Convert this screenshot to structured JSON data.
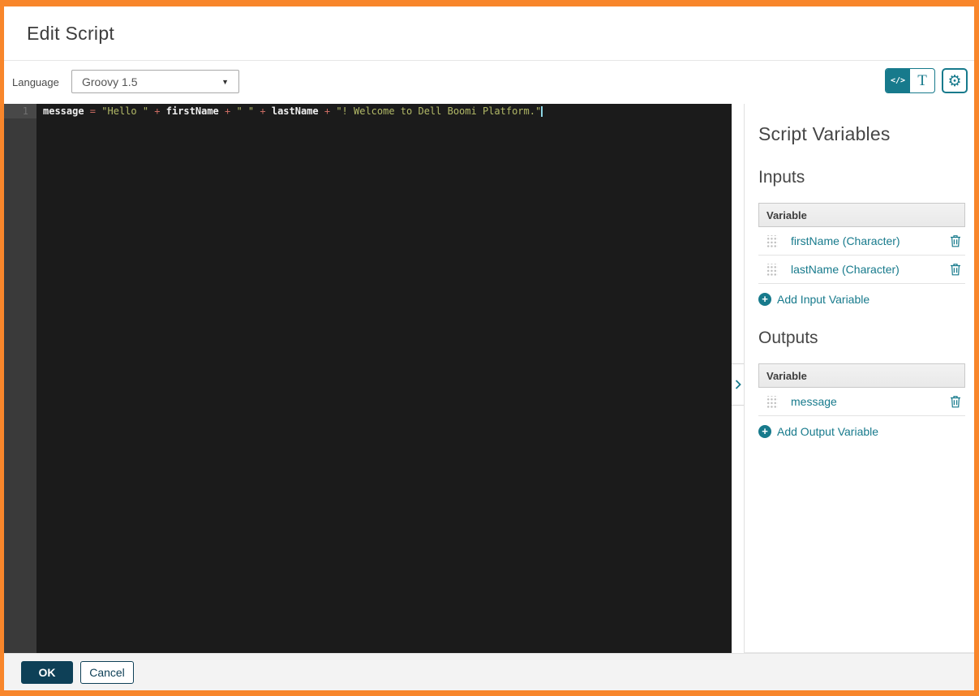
{
  "theme": {
    "accent_orange": "#F8862B",
    "teal": "#177A8C",
    "button_navy": "#0E4057",
    "editor_background": "#1B1B1B",
    "string_color": "#B2B967",
    "operator_color": "#C96B62"
  },
  "header": {
    "title": "Edit Script"
  },
  "toolbar": {
    "language_label": "Language",
    "language_value": "Groovy 1.5"
  },
  "icons": {
    "dropdown_arrow": "▼",
    "code_view": "</>",
    "text_view": "T",
    "gear": "⚙",
    "plus": "+"
  },
  "editor": {
    "line_number": "1",
    "code_text": "message = \"Hello \" + firstName + \" \" + lastName + \"! Welcome to Dell Boomi Platform.\"",
    "tokens": [
      {
        "text": "message",
        "type": "identifier"
      },
      {
        "text": " = ",
        "type": "operator"
      },
      {
        "text": "\"Hello \"",
        "type": "string"
      },
      {
        "text": " + ",
        "type": "operator"
      },
      {
        "text": "firstName",
        "type": "identifier"
      },
      {
        "text": " + ",
        "type": "operator"
      },
      {
        "text": "\" \"",
        "type": "string"
      },
      {
        "text": " + ",
        "type": "operator"
      },
      {
        "text": "lastName",
        "type": "identifier"
      },
      {
        "text": " + ",
        "type": "operator"
      },
      {
        "text": "\"! Welcome to Dell Boomi Platform.\"",
        "type": "string"
      }
    ]
  },
  "variables_panel": {
    "title": "Script Variables",
    "inputs": {
      "heading": "Inputs",
      "column_header": "Variable",
      "rows": [
        {
          "label": "firstName (Character)"
        },
        {
          "label": "lastName (Character)"
        }
      ],
      "add_label": "Add Input Variable"
    },
    "outputs": {
      "heading": "Outputs",
      "column_header": "Variable",
      "rows": [
        {
          "label": "message"
        }
      ],
      "add_label": "Add Output Variable"
    }
  },
  "footer": {
    "ok_label": "OK",
    "cancel_label": "Cancel"
  }
}
